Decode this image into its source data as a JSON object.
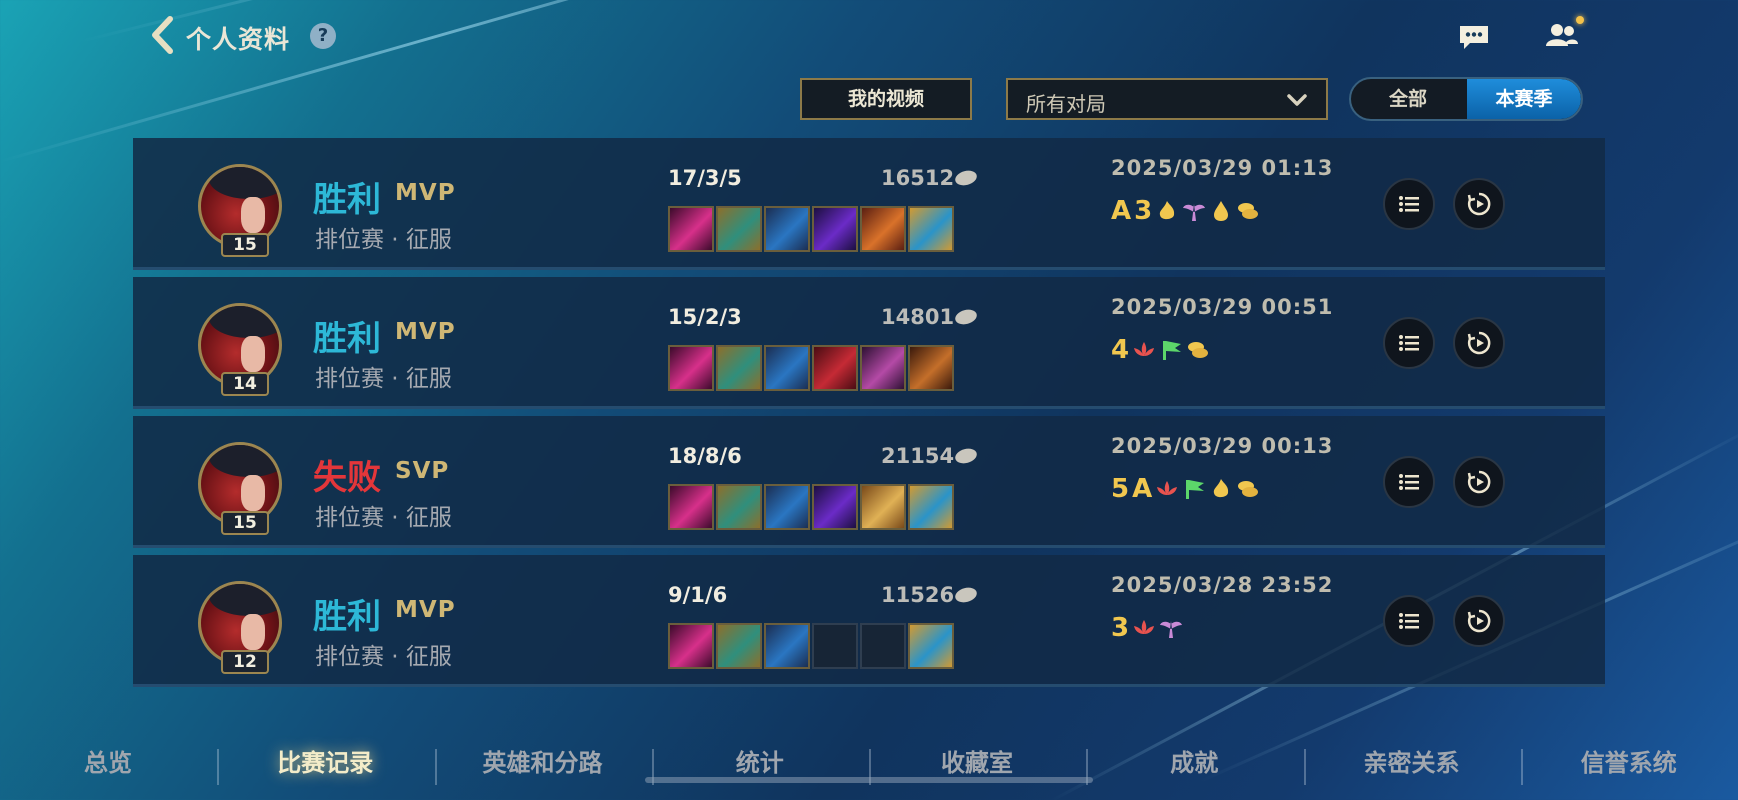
{
  "header": {
    "title": "个人资料",
    "help_glyph": "?"
  },
  "controls": {
    "my_videos_label": "我的视频",
    "match_filter_value": "所有对局",
    "toggle_all": "全部",
    "toggle_season": "本赛季",
    "toggle_selected": "本赛季"
  },
  "matches": [
    {
      "level": "15",
      "result": "胜利",
      "outcome": "win",
      "honor": "MVP",
      "mode": "排位赛 · 征服",
      "kda": "17/3/5",
      "gold": "16512",
      "items": [
        "item-1",
        "item-2",
        "item-3",
        "item-4",
        "item-5",
        "item-6"
      ],
      "date": "2025/03/29 01:13",
      "badges": [
        "A",
        "3",
        "flame-icon",
        "wings-icon",
        "drop-icon",
        "coin-stack-icon"
      ]
    },
    {
      "level": "14",
      "result": "胜利",
      "outcome": "win",
      "honor": "MVP",
      "mode": "排位赛 · 征服",
      "kda": "15/2/3",
      "gold": "14801",
      "items": [
        "item-1",
        "item-2",
        "item-3",
        "item-4",
        "item-5",
        "item-6"
      ],
      "date": "2025/03/29 00:51",
      "badges": [
        "4",
        "lotus-icon",
        "flag-icon",
        "coin-stack-icon"
      ]
    },
    {
      "level": "15",
      "result": "失败",
      "outcome": "loss",
      "honor": "SVP",
      "mode": "排位赛 · 征服",
      "kda": "18/8/6",
      "gold": "21154",
      "items": [
        "item-1",
        "item-2",
        "item-3",
        "item-4",
        "item-5",
        "item-6"
      ],
      "date": "2025/03/29 00:13",
      "badges": [
        "5",
        "A",
        "lotus-icon",
        "flag-icon",
        "flame-icon",
        "coin-stack-icon"
      ]
    },
    {
      "level": "12",
      "result": "胜利",
      "outcome": "win",
      "honor": "MVP",
      "mode": "排位赛 · 征服",
      "kda": "9/1/6",
      "gold": "11526",
      "items": [
        "item-1",
        "item-2",
        "item-3",
        "empty",
        "empty",
        "item-6"
      ],
      "date": "2025/03/28 23:52",
      "badges": [
        "3",
        "lotus-icon",
        "wings-icon"
      ]
    }
  ],
  "nav": {
    "tabs": [
      "总览",
      "比赛记录",
      "英雄和分路",
      "统计",
      "收藏室",
      "成就",
      "亲密关系",
      "信誉系统"
    ],
    "active": "比赛记录"
  },
  "colors": {
    "win": "#2db8d7",
    "loss": "#e3363a",
    "honor": "#cfb775",
    "badge": "#f1c74f",
    "toggle_active": "#1778c2"
  }
}
